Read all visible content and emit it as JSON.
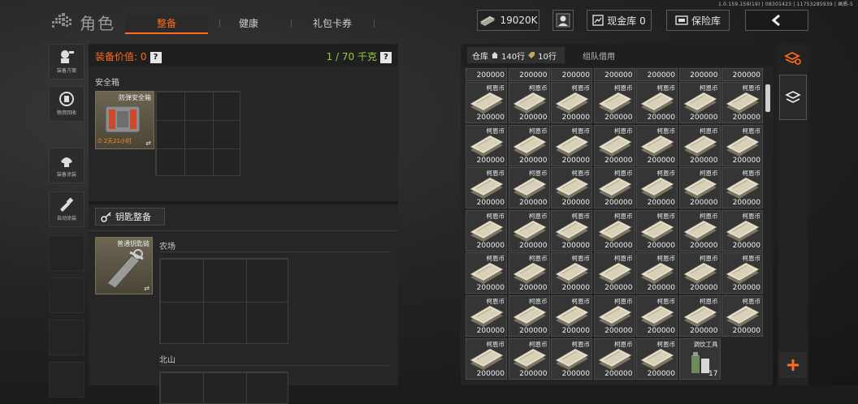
{
  "version_text": "1.0.159.159(19) | 08301423 | 11753285939 | 画质-5",
  "header": {
    "title": "角色",
    "tabs": [
      {
        "label": "整备",
        "active": true
      },
      {
        "label": "健康",
        "active": false
      },
      {
        "label": "礼包卡券",
        "active": false
      }
    ],
    "currency": "19020K",
    "cash_vault": "现金库 0",
    "insurance_vault": "保险库"
  },
  "sidebar": {
    "items": [
      {
        "label": "装备方案",
        "icon": "loadout-icon"
      },
      {
        "label": "物资回收",
        "icon": "recycle-icon"
      },
      {
        "label": "装备涂装",
        "icon": "paint-icon"
      },
      {
        "label": "自动涂装",
        "icon": "auto-paint-icon"
      }
    ]
  },
  "equipment": {
    "value_label": "装备价值: 0",
    "weight_label": "1 / 70 千克",
    "safe_box": {
      "section_title": "安全箱",
      "item_name": "防弹安全箱",
      "timer": "2天21小时"
    },
    "keychain": {
      "button_label": "钥匙整备",
      "item_name": "普通钥匙链",
      "zones": [
        "农场",
        "北山"
      ]
    }
  },
  "warehouse": {
    "tab_label": "仓库",
    "home_rows": "140行",
    "tag_rows": "10行",
    "team_tab": "组队借用",
    "item": {
      "name": "柯恩币",
      "amount": "200000"
    },
    "top_row_count": 7,
    "full_rows": 6,
    "last_row_money": 5,
    "last_special": {
      "name": "调饮工具",
      "count": "17"
    }
  },
  "colors": {
    "accent": "#ff6a1f",
    "weight_green": "#9acd32"
  }
}
